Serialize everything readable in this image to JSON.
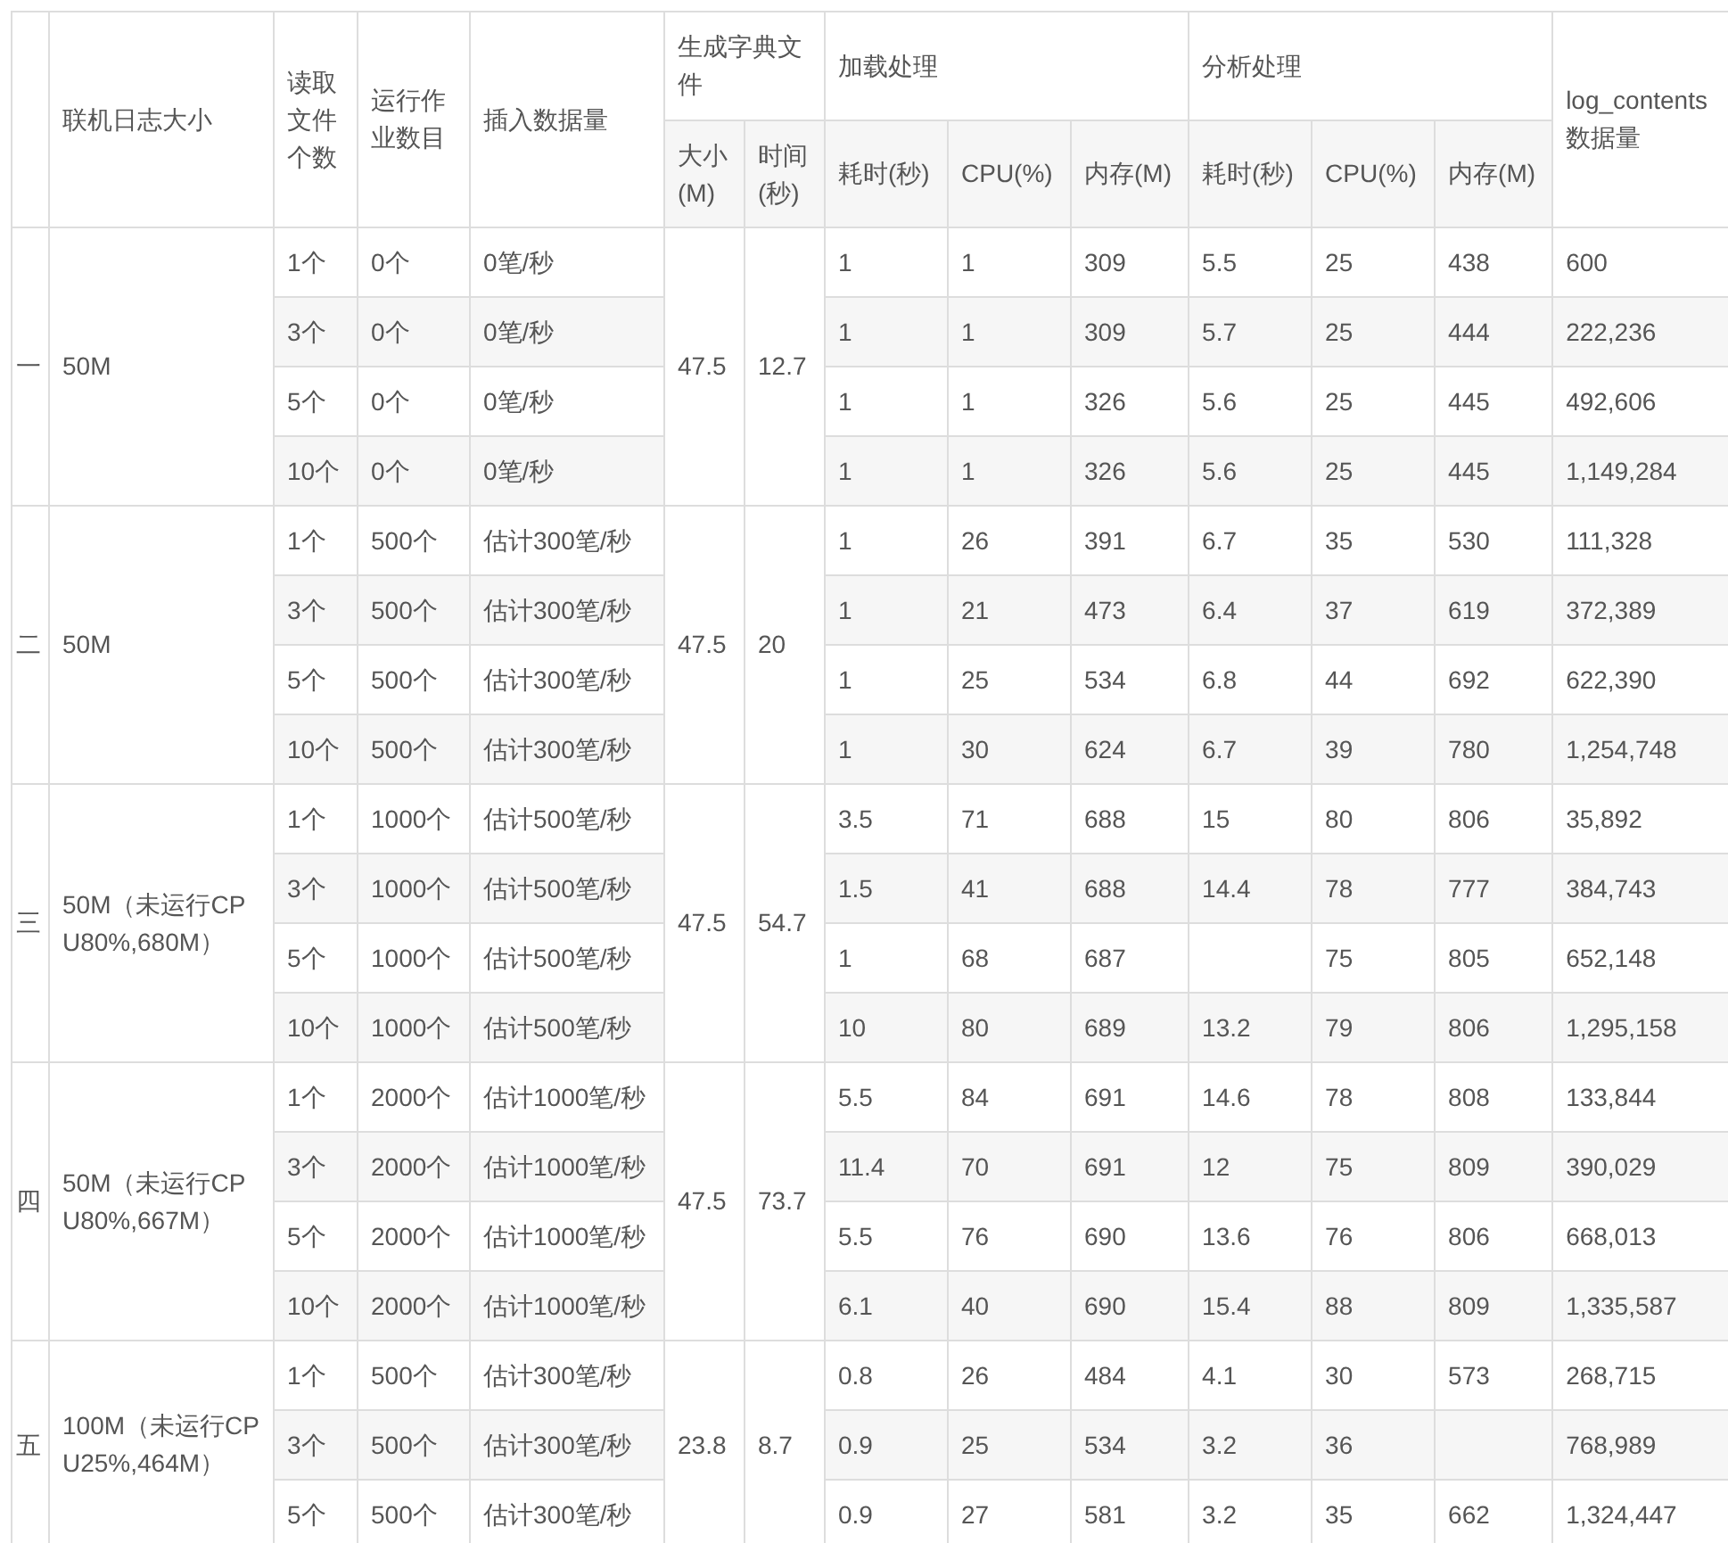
{
  "table": {
    "header_top": [
      {
        "text": "联机日志大小",
        "rowspan": 2
      },
      {
        "text": "读取文件个数",
        "rowspan": 2
      },
      {
        "text": "运行作业数目",
        "rowspan": 2
      },
      {
        "text": "插入数据量",
        "rowspan": 2
      },
      {
        "text": "生成字典文件",
        "colspan": 2
      },
      {
        "text": "加载处理",
        "colspan": 3
      },
      {
        "text": "分析处理",
        "colspan": 3
      },
      {
        "lines": [
          "log_contents",
          "数据量"
        ],
        "rowspan": 2
      }
    ],
    "header_sub": [
      "大小(M)",
      "时间(秒)",
      "耗时(秒)",
      "CPU(%)",
      "内存(M)",
      "耗时(秒)",
      "CPU(%)",
      "内存(M)"
    ],
    "groups": [
      {
        "label": "一",
        "size": "50M",
        "dict_size": "47.5",
        "dict_time": "12.7",
        "rows": [
          {
            "files": "1个",
            "jobs": "0个",
            "insert": "0笔/秒",
            "load_time": "1",
            "load_cpu": "1",
            "load_mem": "309",
            "an_time": "5.5",
            "an_cpu": "25",
            "an_mem": "438",
            "count": "600"
          },
          {
            "files": "3个",
            "jobs": "0个",
            "insert": "0笔/秒",
            "load_time": "1",
            "load_cpu": "1",
            "load_mem": "309",
            "an_time": "5.7",
            "an_cpu": "25",
            "an_mem": "444",
            "count": "222,236"
          },
          {
            "files": "5个",
            "jobs": "0个",
            "insert": "0笔/秒",
            "load_time": "1",
            "load_cpu": "1",
            "load_mem": "326",
            "an_time": "5.6",
            "an_cpu": "25",
            "an_mem": "445",
            "count": "492,606"
          },
          {
            "files": "10个",
            "jobs": "0个",
            "insert": "0笔/秒",
            "load_time": "1",
            "load_cpu": "1",
            "load_mem": "326",
            "an_time": "5.6",
            "an_cpu": "25",
            "an_mem": "445",
            "count": "1,149,284"
          }
        ]
      },
      {
        "label": "二",
        "size": "50M",
        "dict_size": "47.5",
        "dict_time": "20",
        "rows": [
          {
            "files": "1个",
            "jobs": "500个",
            "insert": "估计300笔/秒",
            "load_time": "1",
            "load_cpu": "26",
            "load_mem": "391",
            "an_time": "6.7",
            "an_cpu": "35",
            "an_mem": "530",
            "count": "111,328"
          },
          {
            "files": "3个",
            "jobs": "500个",
            "insert": "估计300笔/秒",
            "load_time": "1",
            "load_cpu": "21",
            "load_mem": "473",
            "an_time": "6.4",
            "an_cpu": "37",
            "an_mem": "619",
            "count": "372,389"
          },
          {
            "files": "5个",
            "jobs": "500个",
            "insert": "估计300笔/秒",
            "load_time": "1",
            "load_cpu": "25",
            "load_mem": "534",
            "an_time": "6.8",
            "an_cpu": "44",
            "an_mem": "692",
            "count": "622,390"
          },
          {
            "files": "10个",
            "jobs": "500个",
            "insert": "估计300笔/秒",
            "load_time": "1",
            "load_cpu": "30",
            "load_mem": "624",
            "an_time": "6.7",
            "an_cpu": "39",
            "an_mem": "780",
            "count": "1,254,748"
          }
        ]
      },
      {
        "label": "三",
        "size": "50M（未运行CPU80%,680M）",
        "dict_size": "47.5",
        "dict_time": "54.7",
        "rows": [
          {
            "files": "1个",
            "jobs": "1000个",
            "insert": "估计500笔/秒",
            "load_time": "3.5",
            "load_cpu": "71",
            "load_mem": "688",
            "an_time": "15",
            "an_cpu": "80",
            "an_mem": "806",
            "count": "35,892"
          },
          {
            "files": "3个",
            "jobs": "1000个",
            "insert": "估计500笔/秒",
            "load_time": "1.5",
            "load_cpu": "41",
            "load_mem": "688",
            "an_time": "14.4",
            "an_cpu": "78",
            "an_mem": "777",
            "count": "384,743"
          },
          {
            "files": "5个",
            "jobs": "1000个",
            "insert": "估计500笔/秒",
            "load_time": "1",
            "load_cpu": "68",
            "load_mem": "687",
            "an_cpu": "75",
            "an_mem": "805",
            "count": "652,148"
          },
          {
            "files": "10个",
            "jobs": "1000个",
            "insert": "估计500笔/秒",
            "load_time": "10",
            "load_cpu": "80",
            "load_mem": "689",
            "an_time": "13.2",
            "an_cpu": "79",
            "an_mem": "806",
            "count": "1,295,158"
          }
        ]
      },
      {
        "label": "四",
        "size": "50M（未运行CPU80%,667M）",
        "dict_size": "47.5",
        "dict_time": "73.7",
        "rows": [
          {
            "files": "1个",
            "jobs": "2000个",
            "insert": "估计1000笔/秒",
            "load_time": "5.5",
            "load_cpu": "84",
            "load_mem": "691",
            "an_time": "14.6",
            "an_cpu": "78",
            "an_mem": "808",
            "count": "133,844"
          },
          {
            "files": "3个",
            "jobs": "2000个",
            "insert": "估计1000笔/秒",
            "load_time": "11.4",
            "load_cpu": "70",
            "load_mem": "691",
            "an_time": "12",
            "an_cpu": "75",
            "an_mem": "809",
            "count": "390,029"
          },
          {
            "files": "5个",
            "jobs": "2000个",
            "insert": "估计1000笔/秒",
            "load_time": "5.5",
            "load_cpu": "76",
            "load_mem": "690",
            "an_time": "13.6",
            "an_cpu": "76",
            "an_mem": "806",
            "count": "668,013"
          },
          {
            "files": "10个",
            "jobs": "2000个",
            "insert": "估计1000笔/秒",
            "load_time": "6.1",
            "load_cpu": "40",
            "load_mem": "690",
            "an_time": "15.4",
            "an_cpu": "88",
            "an_mem": "809",
            "count": "1,335,587"
          }
        ]
      },
      {
        "label": "五",
        "size": "100M（未运行CPU25%,464M）",
        "dict_size": "23.8",
        "dict_time": "8.7",
        "rows": [
          {
            "files": "1个",
            "jobs": "500个",
            "insert": "估计300笔/秒",
            "load_time": "0.8",
            "load_cpu": "26",
            "load_mem": "484",
            "an_time": "4.1",
            "an_cpu": "30",
            "an_mem": "573",
            "count": "268,715"
          },
          {
            "files": "3个",
            "jobs": "500个",
            "insert": "估计300笔/秒",
            "load_time": "0.9",
            "load_cpu": "25",
            "load_mem": "534",
            "an_time": "3.2",
            "an_cpu": "36",
            "count": "768,989"
          },
          {
            "files": "5个",
            "jobs": "500个",
            "insert": "估计300笔/秒",
            "load_time": "0.9",
            "load_cpu": "27",
            "load_mem": "581",
            "an_time": "3.2",
            "an_cpu": "35",
            "an_mem": "662",
            "count": "1,324,447"
          }
        ]
      }
    ]
  }
}
